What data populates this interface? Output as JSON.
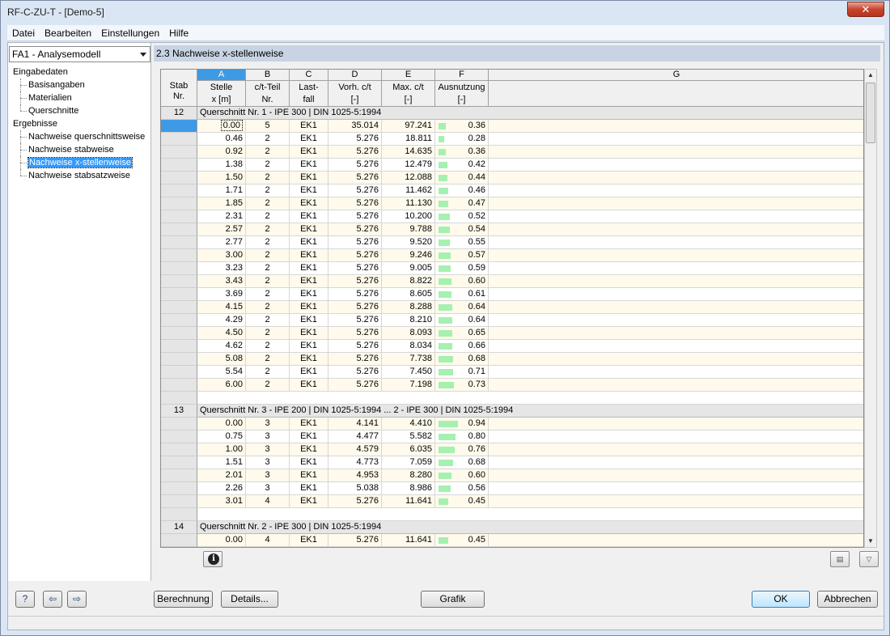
{
  "window": {
    "title": "RF-C-ZU-T - [Demo-5]",
    "close_label": "✕"
  },
  "menu": [
    "Datei",
    "Bearbeiten",
    "Einstellungen",
    "Hilfe"
  ],
  "model_select": "FA1 - Analysemodell",
  "tree": {
    "input_label": "Eingabedaten",
    "input_items": [
      "Basisangaben",
      "Materialien",
      "Querschnitte"
    ],
    "results_label": "Ergebnisse",
    "results_items": [
      "Nachweise querschnittsweise",
      "Nachweise stabweise",
      "Nachweise x-stellenweise",
      "Nachweise stabsatzweise"
    ],
    "selected": "Nachweise x-stellenweise"
  },
  "panel_title": "2.3 Nachweise x-stellenweise",
  "table": {
    "stab_header": [
      "Stab",
      "Nr."
    ],
    "columns": [
      {
        "letter": "A",
        "line1": "Stelle",
        "line2": "x [m]"
      },
      {
        "letter": "B",
        "line1": "c/t-Teil",
        "line2": "Nr."
      },
      {
        "letter": "C",
        "line1": "Last-",
        "line2": "fall"
      },
      {
        "letter": "D",
        "line1": "Vorh. c/t",
        "line2": "[-]"
      },
      {
        "letter": "E",
        "line1": "Max. c/t",
        "line2": "[-]"
      },
      {
        "letter": "F",
        "line1": "Ausnutzung",
        "line2": "[-]"
      },
      {
        "letter": "G",
        "line1": "",
        "line2": ""
      }
    ],
    "groups": [
      {
        "stab": "12",
        "label": "Querschnitt  Nr.  1 - IPE 300 | DIN 1025-5:1994",
        "rows": [
          [
            "0.00",
            "5",
            "EK1",
            "35.014",
            "97.241",
            "0.36"
          ],
          [
            "0.46",
            "2",
            "EK1",
            "5.276",
            "18.811",
            "0.28"
          ],
          [
            "0.92",
            "2",
            "EK1",
            "5.276",
            "14.635",
            "0.36"
          ],
          [
            "1.38",
            "2",
            "EK1",
            "5.276",
            "12.479",
            "0.42"
          ],
          [
            "1.50",
            "2",
            "EK1",
            "5.276",
            "12.088",
            "0.44"
          ],
          [
            "1.71",
            "2",
            "EK1",
            "5.276",
            "11.462",
            "0.46"
          ],
          [
            "1.85",
            "2",
            "EK1",
            "5.276",
            "11.130",
            "0.47"
          ],
          [
            "2.31",
            "2",
            "EK1",
            "5.276",
            "10.200",
            "0.52"
          ],
          [
            "2.57",
            "2",
            "EK1",
            "5.276",
            "9.788",
            "0.54"
          ],
          [
            "2.77",
            "2",
            "EK1",
            "5.276",
            "9.520",
            "0.55"
          ],
          [
            "3.00",
            "2",
            "EK1",
            "5.276",
            "9.246",
            "0.57"
          ],
          [
            "3.23",
            "2",
            "EK1",
            "5.276",
            "9.005",
            "0.59"
          ],
          [
            "3.43",
            "2",
            "EK1",
            "5.276",
            "8.822",
            "0.60"
          ],
          [
            "3.69",
            "2",
            "EK1",
            "5.276",
            "8.605",
            "0.61"
          ],
          [
            "4.15",
            "2",
            "EK1",
            "5.276",
            "8.288",
            "0.64"
          ],
          [
            "4.29",
            "2",
            "EK1",
            "5.276",
            "8.210",
            "0.64"
          ],
          [
            "4.50",
            "2",
            "EK1",
            "5.276",
            "8.093",
            "0.65"
          ],
          [
            "4.62",
            "2",
            "EK1",
            "5.276",
            "8.034",
            "0.66"
          ],
          [
            "5.08",
            "2",
            "EK1",
            "5.276",
            "7.738",
            "0.68"
          ],
          [
            "5.54",
            "2",
            "EK1",
            "5.276",
            "7.450",
            "0.71"
          ],
          [
            "6.00",
            "2",
            "EK1",
            "5.276",
            "7.198",
            "0.73"
          ]
        ]
      },
      {
        "stab": "13",
        "label": "Querschnitt  Nr. 3 - IPE 200 | DIN 1025-5:1994 ... 2 - IPE 300 | DIN 1025-5:1994",
        "rows": [
          [
            "0.00",
            "3",
            "EK1",
            "4.141",
            "4.410",
            "0.94"
          ],
          [
            "0.75",
            "3",
            "EK1",
            "4.477",
            "5.582",
            "0.80"
          ],
          [
            "1.00",
            "3",
            "EK1",
            "4.579",
            "6.035",
            "0.76"
          ],
          [
            "1.51",
            "3",
            "EK1",
            "4.773",
            "7.059",
            "0.68"
          ],
          [
            "2.01",
            "3",
            "EK1",
            "4.953",
            "8.280",
            "0.60"
          ],
          [
            "2.26",
            "3",
            "EK1",
            "5.038",
            "8.986",
            "0.56"
          ],
          [
            "3.01",
            "4",
            "EK1",
            "5.276",
            "11.641",
            "0.45"
          ]
        ]
      },
      {
        "stab": "14",
        "label": "Querschnitt  Nr.  2 - IPE 300 | DIN 1025-5:1994",
        "rows": [
          [
            "0.00",
            "4",
            "EK1",
            "5.276",
            "11.641",
            "0.45"
          ]
        ]
      }
    ]
  },
  "buttons": {
    "berechnung": "Berechnung",
    "details": "Details...",
    "grafik": "Grafik",
    "ok": "OK",
    "abbrechen": "Abbrechen"
  }
}
